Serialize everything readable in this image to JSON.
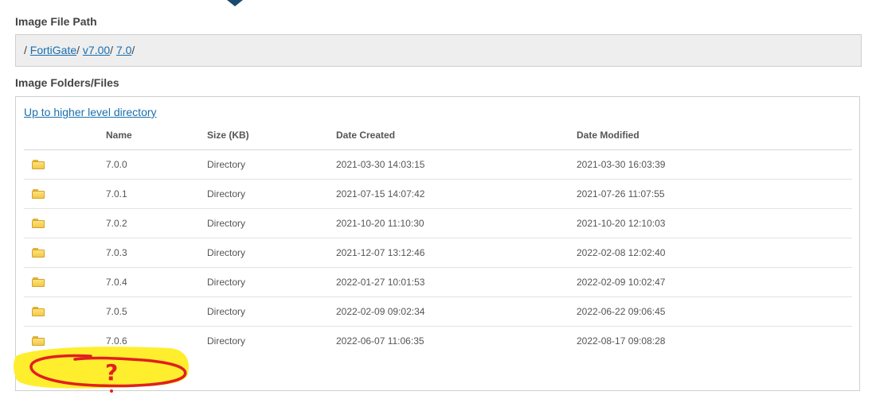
{
  "labels": {
    "image_file_path": "Image File Path",
    "image_folders_files": "Image Folders/Files"
  },
  "breadcrumb": {
    "root_sep": "/",
    "items": [
      {
        "label": "FortiGate",
        "sep": "/"
      },
      {
        "label": "v7.00",
        "sep": "/"
      },
      {
        "label": "7.0",
        "sep": "/"
      }
    ]
  },
  "files": {
    "up_link": "Up to higher level directory",
    "columns": {
      "name": "Name",
      "size": "Size (KB)",
      "created": "Date Created",
      "modified": "Date Modified"
    },
    "rows": [
      {
        "icon": "folder-icon",
        "name": "7.0.0",
        "size": "Directory",
        "created": "2021-03-30 14:03:15",
        "modified": "2021-03-30 16:03:39"
      },
      {
        "icon": "folder-icon",
        "name": "7.0.1",
        "size": "Directory",
        "created": "2021-07-15 14:07:42",
        "modified": "2021-07-26 11:07:55"
      },
      {
        "icon": "folder-icon",
        "name": "7.0.2",
        "size": "Directory",
        "created": "2021-10-20 11:10:30",
        "modified": "2021-10-20 12:10:03"
      },
      {
        "icon": "folder-icon",
        "name": "7.0.3",
        "size": "Directory",
        "created": "2021-12-07 13:12:46",
        "modified": "2022-02-08 12:02:40"
      },
      {
        "icon": "folder-icon",
        "name": "7.0.4",
        "size": "Directory",
        "created": "2022-01-27 10:01:53",
        "modified": "2022-02-09 10:02:47"
      },
      {
        "icon": "folder-icon",
        "name": "7.0.5",
        "size": "Directory",
        "created": "2022-02-09 09:02:34",
        "modified": "2022-06-22 09:06:45"
      },
      {
        "icon": "folder-icon",
        "name": "7.0.6",
        "size": "Directory",
        "created": "2022-06-07 11:06:35",
        "modified": "2022-08-17 09:08:28"
      }
    ]
  },
  "annotation": {
    "text": "?",
    "highlight_color": "#ffee2e",
    "ink_color": "#e02020"
  },
  "colors": {
    "link": "#1a6faf",
    "path_bg": "#eeeeee",
    "folder": "#f2c94a"
  }
}
